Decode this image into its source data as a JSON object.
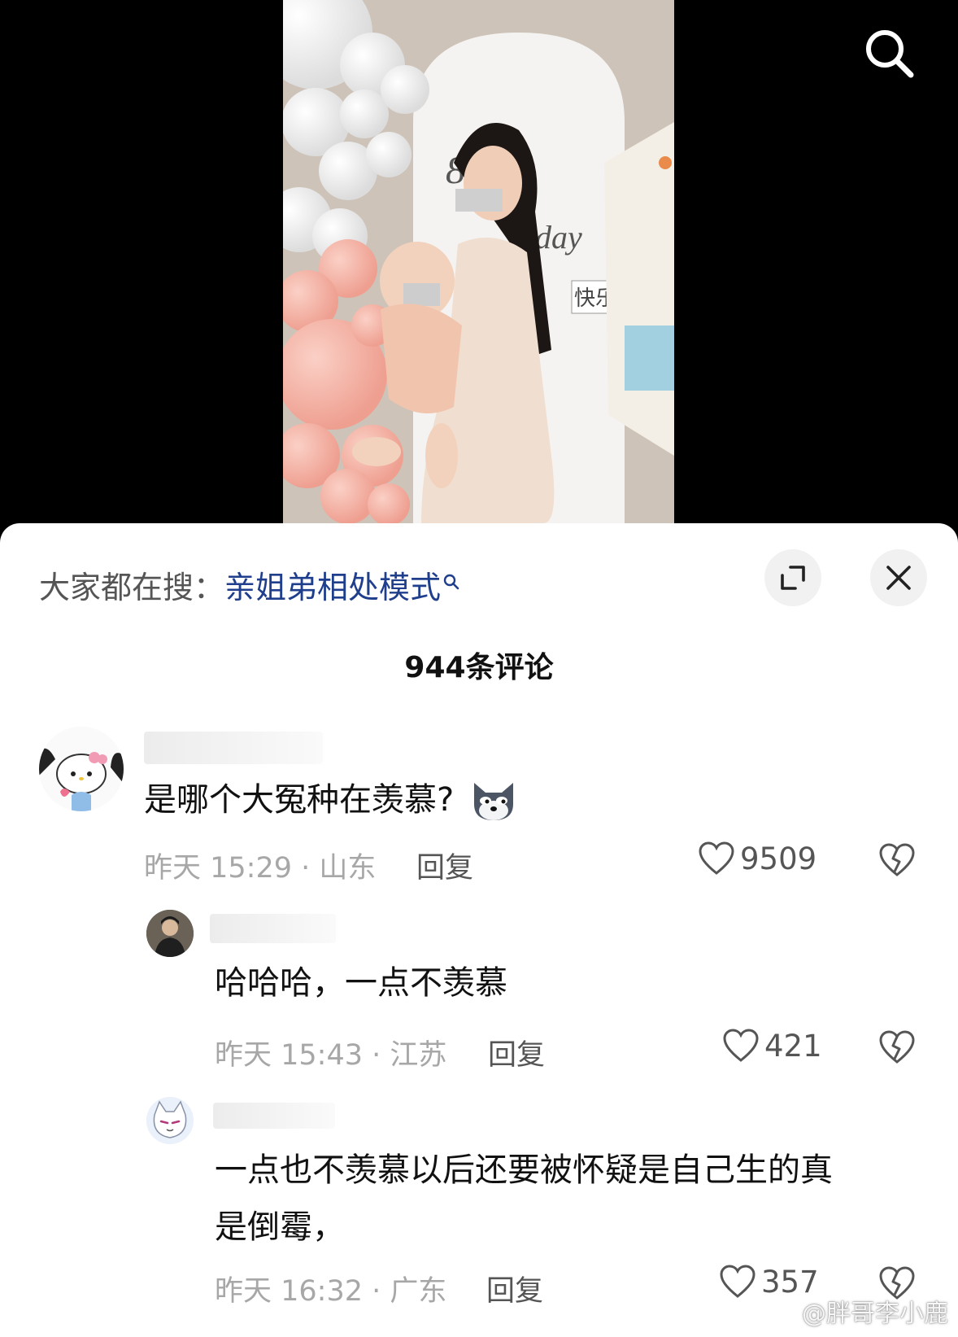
{
  "hot_search": {
    "prefix": "大家都在搜：",
    "term": "亲姐弟相处模式"
  },
  "comments_header": {
    "count_label": "944条评论"
  },
  "comments": [
    {
      "text": "是哪个大冤种在羡慕?",
      "time": "昨天 15:29 · 山东",
      "reply_label": "回复",
      "likes": "9509"
    },
    {
      "text": "哈哈哈，一点不羡慕",
      "time": "昨天 15:43 · 江苏",
      "reply_label": "回复",
      "likes": "421"
    },
    {
      "text_line1": "一点也不羡慕以后还要被怀疑是自己生的真",
      "text_line2": "是倒霉，",
      "time": "昨天 16:32 · 广东",
      "reply_label": "回复",
      "likes": "357"
    }
  ],
  "video": {
    "sign_text_1": "8th",
    "sign_text_2": "day",
    "sign_text_3": "快乐"
  },
  "watermark": "@胖哥李小鹿",
  "colors": {
    "search_term": "#1f3e8c",
    "sheet_bg": "#ffffff",
    "meta_text": "#a7a7a7"
  }
}
